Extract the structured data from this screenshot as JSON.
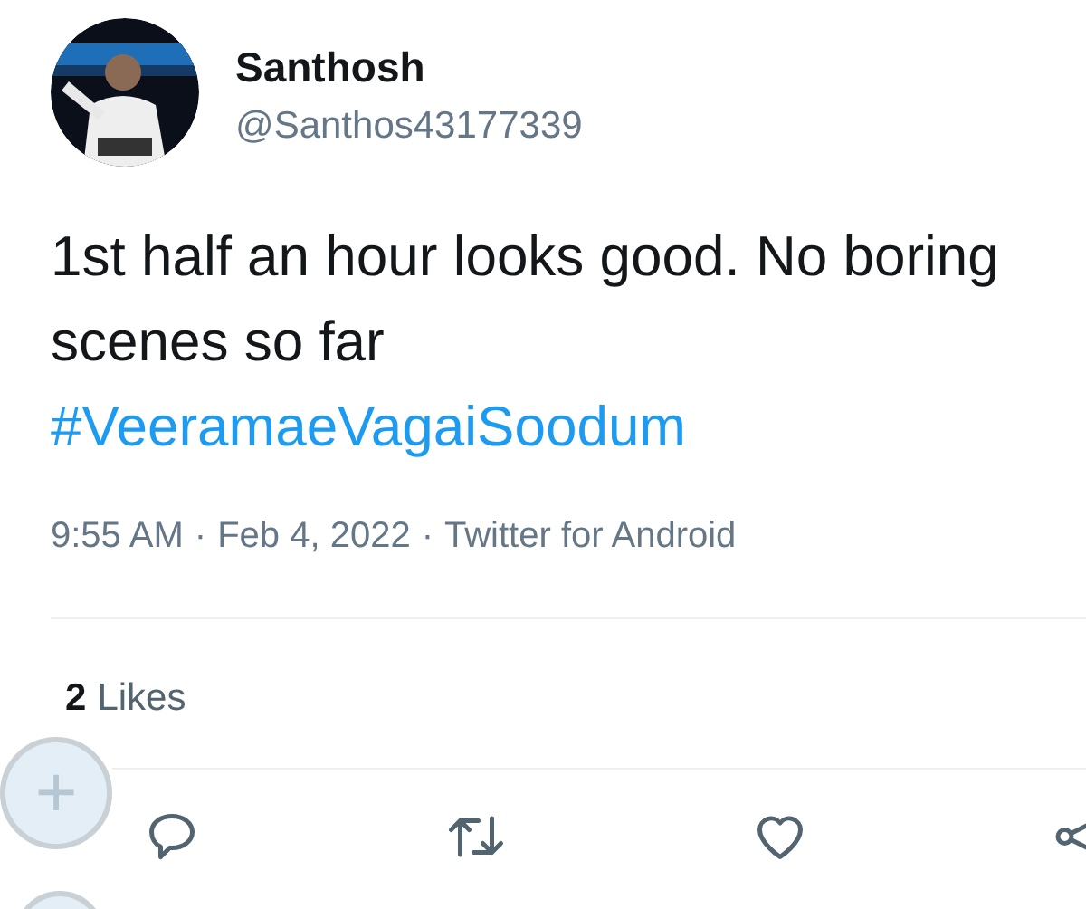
{
  "author": {
    "name": "Santhosh",
    "handle": "@Santhos43177339"
  },
  "tweet": {
    "text": "1st half an hour looks good. No boring scenes so far",
    "hashtag": "#VeeramaeVagaiSoodum"
  },
  "meta": {
    "time": "9:55 AM",
    "separator_1": "·",
    "date": "Feb 4, 2022",
    "separator_2": "·",
    "source": "Twitter for Android"
  },
  "likes": {
    "count": "2",
    "label": "Likes"
  },
  "actions": [
    {
      "kind": "reply"
    },
    {
      "kind": "retweet"
    },
    {
      "kind": "like"
    },
    {
      "kind": "share"
    }
  ],
  "floating_buttons": [
    {
      "label": "+"
    }
  ]
}
